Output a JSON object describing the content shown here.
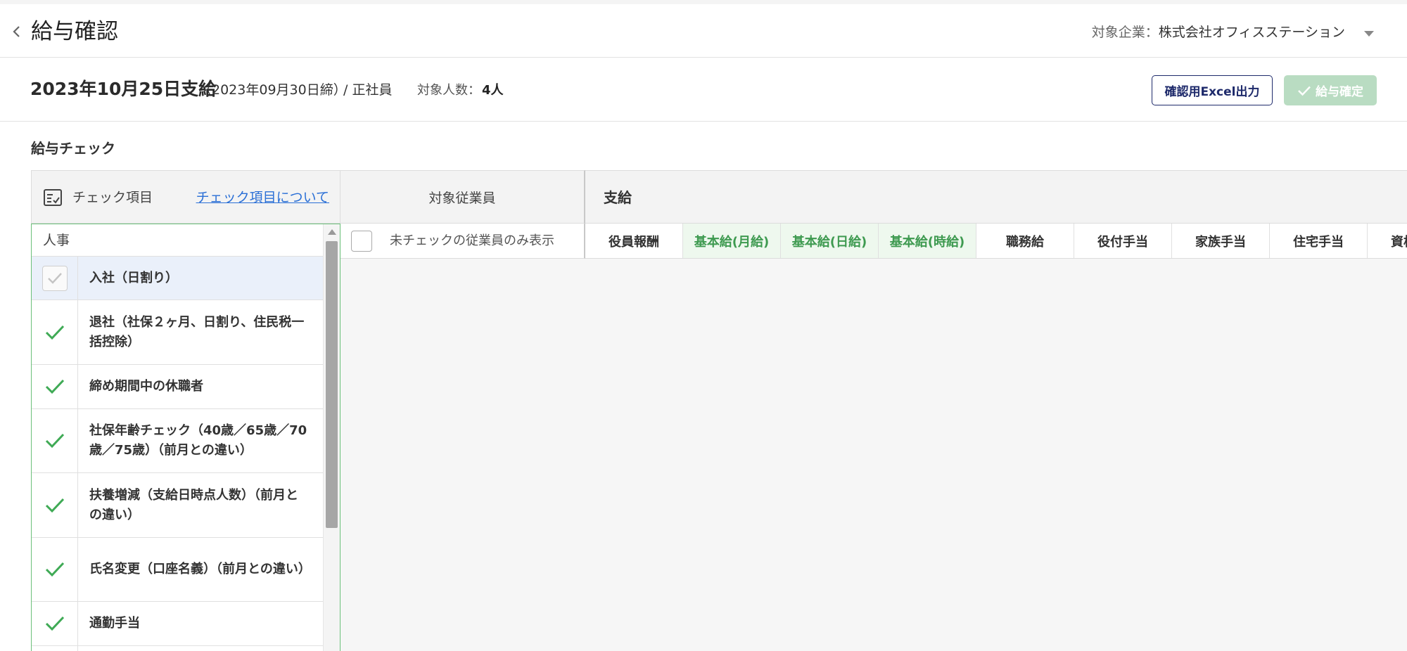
{
  "header": {
    "title": "給与確認",
    "company_label": "対象企業：",
    "company_name": "株式会社オフィスステーション"
  },
  "subheader": {
    "pay_date": "2023年10月25日支給",
    "closing": "（2023年09月30日締）",
    "employee_type": "/ 正社員",
    "count_label": "対象人数：",
    "count_value": "4人",
    "excel_button": "確認用Excel出力",
    "confirm_button": "給与確定"
  },
  "section_title": "給与チェック",
  "check_panel": {
    "header_label": "チェック項目",
    "about_link": "チェック項目について",
    "category": "人事",
    "items": [
      {
        "label": "入社（日割り）"
      },
      {
        "label": "退社（社保２ヶ月、日割り、住民税一括控除）"
      },
      {
        "label": "締め期間中の休職者"
      },
      {
        "label": "社保年齢チェック（40歳／65歳／70歳／75歳）（前月との違い）"
      },
      {
        "label": "扶養増減（支給日時点人数）（前月との違い）"
      },
      {
        "label": "氏名変更（口座名義）（前月との違い）"
      },
      {
        "label": "通勤手当"
      }
    ]
  },
  "employee_column": {
    "header": "対象従業員",
    "filter_label": "未チェックの従業員のみ表示"
  },
  "pay_section": {
    "header": "支給",
    "columns": [
      "役員報酬",
      "基本給(月給)",
      "基本給(日給)",
      "基本給(時給)",
      "職務給",
      "役付手当",
      "家族手当",
      "住宅手当",
      "資格手当"
    ]
  },
  "colors": {
    "accent_green": "#3e9a50",
    "navy": "#1e2a6b",
    "link_blue": "#2a6fd6"
  }
}
